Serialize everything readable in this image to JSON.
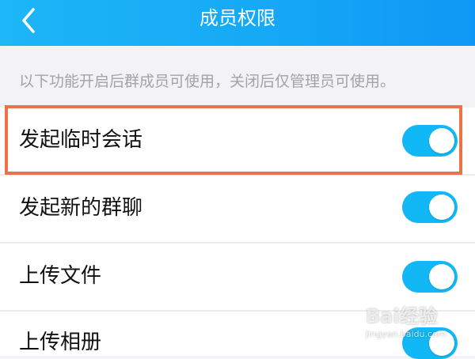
{
  "header": {
    "title": "成员权限",
    "back_icon": "chevron-left-icon",
    "background": "#1aaef6"
  },
  "note": "以下功能开启后群成员可使用，关闭后仅管理员可使用。",
  "settings": [
    {
      "label": "发起临时会话",
      "enabled": true,
      "highlighted": true
    },
    {
      "label": "发起新的群聊",
      "enabled": true,
      "highlighted": false
    },
    {
      "label": "上传文件",
      "enabled": true,
      "highlighted": false
    },
    {
      "label": "上传相册",
      "enabled": true,
      "highlighted": false
    }
  ],
  "colors": {
    "toggle_on": "#12b7f5",
    "highlight_border": "#ea7347",
    "note_text": "#a3a3a8",
    "page_background": "#f3f3f5"
  },
  "watermark": {
    "logo": "Bai经验",
    "url": "jingyan.baidu.com"
  }
}
